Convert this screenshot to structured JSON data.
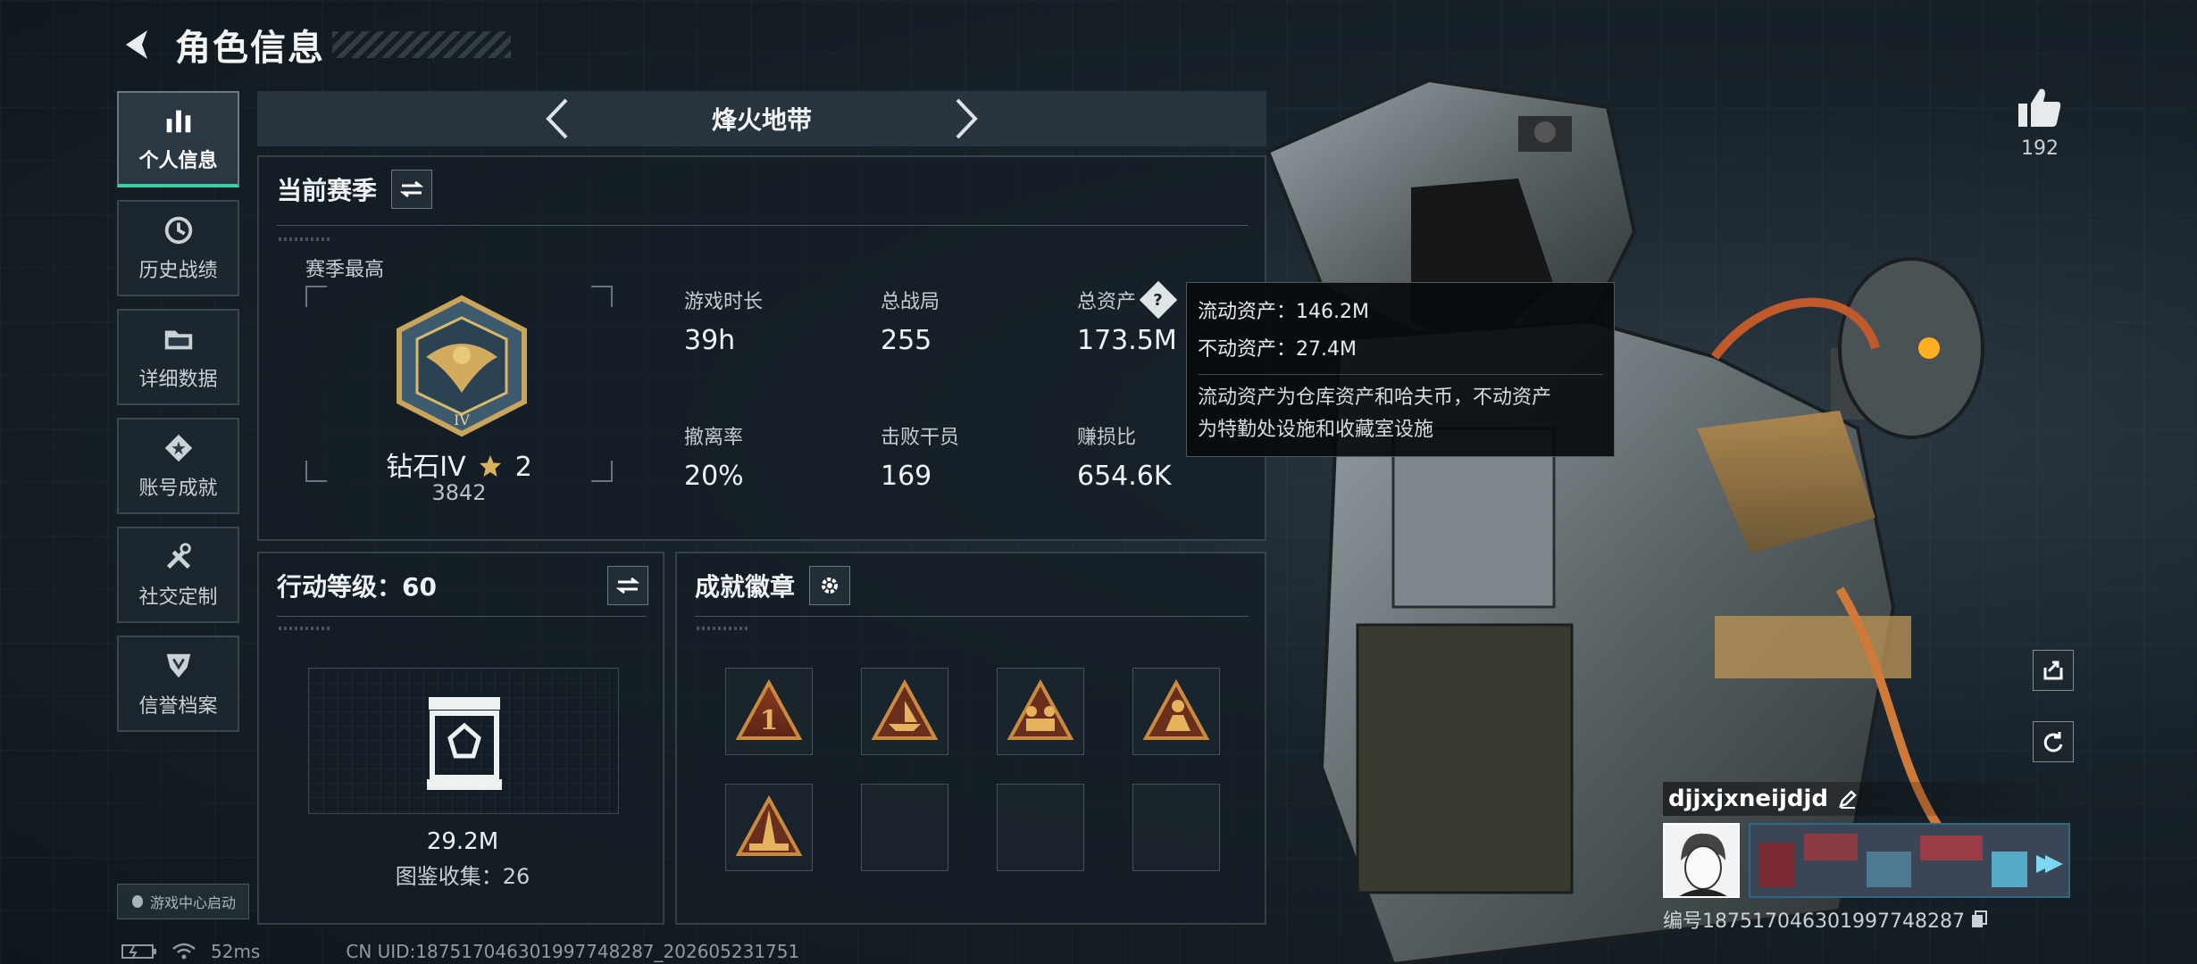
{
  "header": {
    "title": "角色信息"
  },
  "sidebar": {
    "items": [
      {
        "label": "个人信息",
        "icon": "bar-chart-icon",
        "active": true
      },
      {
        "label": "历史战绩",
        "icon": "history-icon",
        "active": false
      },
      {
        "label": "详细数据",
        "icon": "folder-icon",
        "active": false
      },
      {
        "label": "账号成就",
        "icon": "achievement-icon",
        "active": false
      },
      {
        "label": "社交定制",
        "icon": "tools-icon",
        "active": false
      },
      {
        "label": "信誉档案",
        "icon": "shield-icon",
        "active": false
      }
    ],
    "launch_badge": "游戏中心启动"
  },
  "mode_selector": {
    "current": "烽火地带"
  },
  "season": {
    "title": "当前赛季",
    "best_label": "赛季最高",
    "rank_name": "钻石IV",
    "rank_stars": "2",
    "rank_score": "3842",
    "stats": [
      {
        "label": "游戏时长",
        "value": "39h"
      },
      {
        "label": "总战局",
        "value": "255"
      },
      {
        "label": "总资产",
        "value": "173.5M"
      },
      {
        "label": "撤离率",
        "value": "20%"
      },
      {
        "label": "击败干员",
        "value": "169"
      },
      {
        "label": "赚损比",
        "value": "654.6K"
      }
    ]
  },
  "tooltip": {
    "liquid": "流动资产：146.2M",
    "fixed": "不动资产：27.4M",
    "desc_line1": "流动资产为仓库资产和哈夫币，不动资产",
    "desc_line2": "为特勤处设施和收藏室设施"
  },
  "action_level": {
    "title": "行动等级：60",
    "value": "29.2M",
    "collection": "图鉴收集：26"
  },
  "badges": {
    "title": "成就徽章",
    "slots": [
      "badge-1-icon",
      "badge-boat-icon",
      "badge-squad-icon",
      "badge-soldier-icon",
      "badge-tower-icon",
      "",
      "",
      ""
    ]
  },
  "likes": {
    "count": "192"
  },
  "player": {
    "name": "djjxjxneijdjd",
    "id": "编号1875170463019977482​87"
  },
  "status_bar": {
    "ping": "52ms",
    "uid": "CN UID:18751704630199774828​7_202605231751"
  },
  "colors": {
    "accent": "#38d39f",
    "gold": "#c9a45a",
    "panel_bg": "#141e25"
  }
}
